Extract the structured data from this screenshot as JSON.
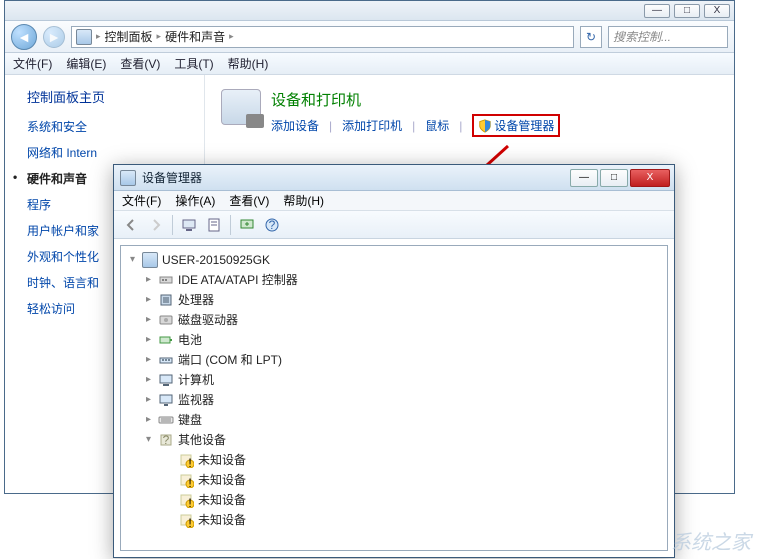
{
  "cp": {
    "titlebar": {
      "min": "—",
      "max": "□",
      "close": "X"
    },
    "breadcrumb": {
      "root": "控制面板",
      "leaf": "硬件和声音"
    },
    "search_placeholder": "搜索控制...",
    "menu": {
      "file": "文件(F)",
      "edit": "编辑(E)",
      "view": "查看(V)",
      "tools": "工具(T)",
      "help": "帮助(H)"
    },
    "sidebar": {
      "title": "控制面板主页",
      "items": [
        "系统和安全",
        "网络和 Intern",
        "硬件和声音",
        "程序",
        "用户帐户和家",
        "外观和个性化",
        "时钟、语言和",
        "轻松访问"
      ],
      "active_index": 2
    },
    "category": {
      "title": "设备和打印机",
      "links": [
        "添加设备",
        "添加打印机",
        "鼠标",
        "设备管理器"
      ]
    }
  },
  "dm": {
    "title": "设备管理器",
    "titlebar": {
      "min": "—",
      "max": "□",
      "close": "X"
    },
    "menu": {
      "file": "文件(F)",
      "action": "操作(A)",
      "view": "查看(V)",
      "help": "帮助(H)"
    },
    "tree": {
      "root": "USER-20150925GK",
      "nodes": [
        {
          "label": "IDE ATA/ATAPI 控制器",
          "icon": "ide"
        },
        {
          "label": "处理器",
          "icon": "cpu"
        },
        {
          "label": "磁盘驱动器",
          "icon": "disk"
        },
        {
          "label": "电池",
          "icon": "battery"
        },
        {
          "label": "端口 (COM 和 LPT)",
          "icon": "port"
        },
        {
          "label": "计算机",
          "icon": "computer"
        },
        {
          "label": "监视器",
          "icon": "monitor"
        },
        {
          "label": "键盘",
          "icon": "keyboard"
        },
        {
          "label": "其他设备",
          "icon": "other",
          "expanded": true,
          "children": [
            "未知设备",
            "未知设备",
            "未知设备",
            "未知设备"
          ]
        }
      ]
    }
  },
  "watermark": "系统之家"
}
